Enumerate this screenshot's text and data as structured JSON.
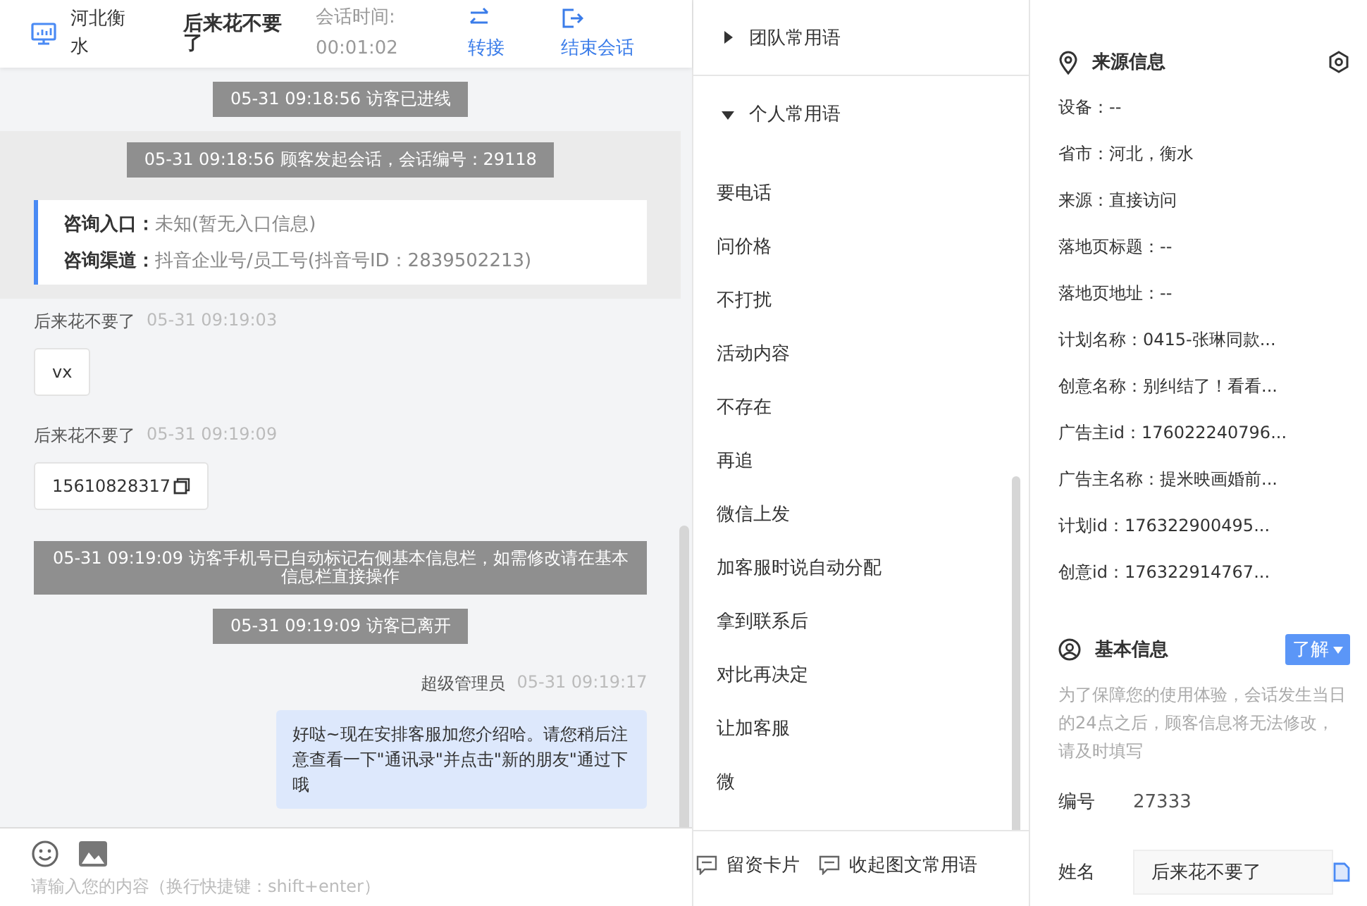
{
  "header": {
    "location": "河北衡水",
    "visitor": "后来花不要了",
    "duration_label": "会话时间:",
    "duration": "00:01:02",
    "actions": [
      {
        "label": "转接",
        "kind": "transfer"
      },
      {
        "label": "结束会话",
        "kind": "end"
      }
    ]
  },
  "messages": [
    {
      "kind": "notice",
      "text": "05-31 09:18:56 访客已进线"
    },
    {
      "kind": "session",
      "notice": "05-31 09:18:56 顾客发起会话，会话编号：29118",
      "fields": [
        {
          "label": "咨询入口：",
          "value": "未知(暂无入口信息)"
        },
        {
          "label": "咨询渠道：",
          "value": "抖音企业号/员工号(抖音号ID：2839502213)"
        }
      ]
    },
    {
      "kind": "visitor",
      "sender": "后来花不要了",
      "time": "05-31 09:19:03",
      "text": "vx",
      "copyable": false
    },
    {
      "kind": "visitor",
      "sender": "后来花不要了",
      "time": "05-31 09:19:09",
      "text": "15610828317",
      "copyable": true
    },
    {
      "kind": "notice",
      "text": "05-31 09:19:09 访客手机号已自动标记右侧基本信息栏，如需修改请在基本信息栏直接操作"
    },
    {
      "kind": "notice",
      "text": "05-31 09:19:09 访客已离开"
    },
    {
      "kind": "agent",
      "sender": "超级管理员",
      "time": "05-31 09:19:17",
      "text": "好哒~现在安排客服加您介绍哈。请您稍后注意查看一下\"通讯录\"并点击\"新的朋友\"通过下哦"
    }
  ],
  "composer": {
    "placeholder": "请输入您的内容（换行快捷键：shift+enter）"
  },
  "phrases": {
    "groups": [
      {
        "title": "团队常用语",
        "expanded": false
      },
      {
        "title": "个人常用语",
        "expanded": true,
        "items": [
          "要电话",
          "问价格",
          "不打扰",
          "活动内容",
          "不存在",
          "再追",
          "微信上发",
          "加客服时说自动分配",
          "拿到联系后",
          "对比再决定",
          "让加客服",
          "微"
        ]
      }
    ],
    "footer": [
      {
        "label": "留资卡片"
      },
      {
        "label": "收起图文常用语"
      }
    ]
  },
  "source_info": {
    "title": "来源信息",
    "rows": [
      "设备：--",
      "省市：河北，衡水",
      "来源：直接访问",
      "落地页标题：--",
      "落地页地址：--",
      "计划名称：0415-张琳同款...",
      "创意名称：别纠结了！看看...",
      "广告主id：176022240796...",
      "广告主名称：提米映画婚前...",
      "计划id：176322900495...",
      "创意id：176322914767..."
    ]
  },
  "basic_info": {
    "title": "基本信息",
    "button": "了解",
    "note": "为了保障您的使用体验，会话发生当日的24点之后，顾客信息将无法修改，请及时填写",
    "fields": [
      {
        "label": "编号",
        "value": "27333",
        "kind": "text"
      },
      {
        "label": "姓名",
        "value": "后来花不要了",
        "kind": "input"
      }
    ]
  }
}
